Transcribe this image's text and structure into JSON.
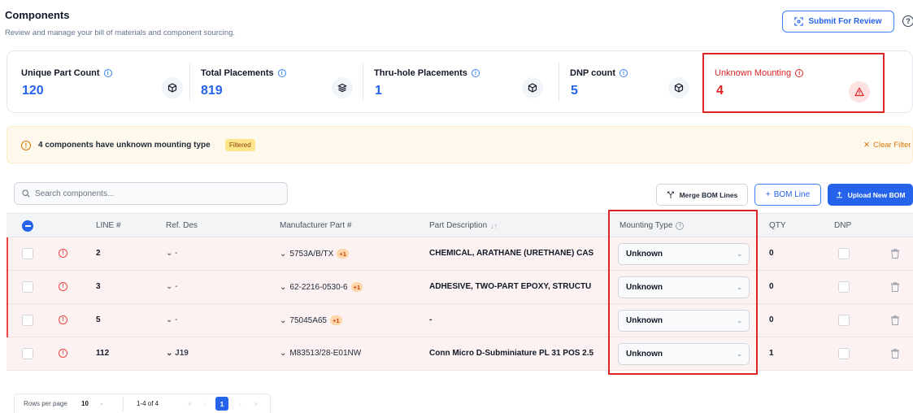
{
  "header": {
    "title": "Components",
    "subtitle": "Review and manage your bill of materials and component sourcing.",
    "submit_label": "Submit For Review",
    "help_glyph": "?"
  },
  "stats": [
    {
      "label": "Unique Part Count",
      "value": "120",
      "icon": "cube-icon"
    },
    {
      "label": "Total Placements",
      "value": "819",
      "icon": "layers-icon"
    },
    {
      "label": "Thru-hole Placements",
      "value": "1",
      "icon": "cube-icon"
    },
    {
      "label": "DNP count",
      "value": "5",
      "icon": "cube-icon"
    },
    {
      "label": "Unknown Mounting",
      "value": "4",
      "icon": "warning-triangle-icon"
    }
  ],
  "banner": {
    "message": "4 components have unknown mounting type",
    "badge": "Filtered",
    "clear_label": "Clear Filter"
  },
  "toolbar": {
    "search_placeholder": "Search components...",
    "merge_label": "Merge BOM Lines",
    "bomline_label": "BOM Line",
    "upload_label": "Upload New BOM"
  },
  "table": {
    "columns": {
      "line": "LINE #",
      "refdes": "Ref. Des",
      "mpn": "Manufacturer Part #",
      "desc": "Part Description",
      "mounting": "Mounting Type",
      "qty": "QTY",
      "dnp": "DNP"
    },
    "rows": [
      {
        "line": "2",
        "refdes": "-",
        "mpn": "5753A/B/TX",
        "alt": "+1",
        "desc": "CHEMICAL, ARATHANE (URETHANE) CAS",
        "mounting": "Unknown",
        "qty": "0"
      },
      {
        "line": "3",
        "refdes": "-",
        "mpn": "62-2216-0530-6",
        "alt": "+1",
        "desc": "ADHESIVE, TWO-PART EPOXY, STRUCTU",
        "mounting": "Unknown",
        "qty": "0"
      },
      {
        "line": "5",
        "refdes": "-",
        "mpn": "75045A65",
        "alt": "+1",
        "desc": "-",
        "mounting": "Unknown",
        "qty": "0"
      },
      {
        "line": "112",
        "refdes": "J19",
        "mpn": "M83513/28-E01NW",
        "alt": "",
        "desc": "Conn Micro D-Subminiature PL 31 POS 2.5",
        "mounting": "Unknown",
        "qty": "1"
      }
    ]
  },
  "pagination": {
    "rows_label": "Rows per page",
    "rows_value": "10",
    "range": "1-4 of 4",
    "current_page": "1"
  },
  "colors": {
    "accent": "#2563eb",
    "danger": "#dc2626",
    "warning": "#d97706"
  }
}
